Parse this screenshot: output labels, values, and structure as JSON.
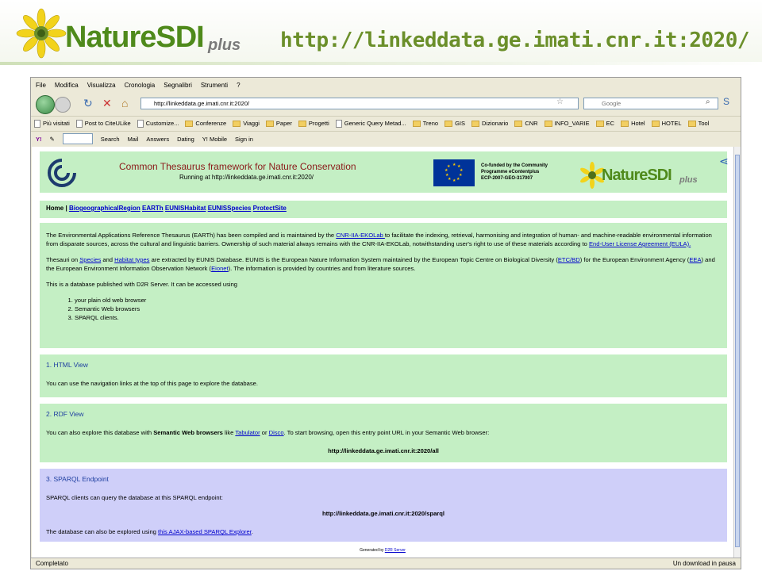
{
  "slide": {
    "logo_word": "NatureSDI",
    "logo_plus": "plus",
    "url": "http://linkeddata.ge.imati.cnr.it:2020/"
  },
  "browser": {
    "menu": [
      "File",
      "Modifica",
      "Visualizza",
      "Cronologia",
      "Segnalibri",
      "Strumenti",
      "?"
    ],
    "address": "http://linkeddata.ge.imati.cnr.it:2020/",
    "search_placeholder": "Google",
    "bookmarks": [
      "Più visitati",
      "Post to CiteULike",
      "Customize...",
      "Conferenze",
      "Viaggi",
      "Paper",
      "Progetti",
      "Generic Query Metad...",
      "Treno",
      "GIS",
      "Dizionario",
      "CNR",
      "INFO_VARIE",
      "EC",
      "Hotel",
      "HOTEL",
      "Tool"
    ],
    "yahoo_toolbar": [
      "Search",
      "Mail",
      "Answers",
      "Dating",
      "Y! Mobile",
      "Sign in"
    ],
    "status_left": "Completato",
    "status_right": "Un download in pausa"
  },
  "page": {
    "title": "Common Thesaurus framework for Nature Conservation",
    "subtitle": "Running at http://linkeddata.ge.imati.cnr.it:2020/",
    "eu_text": [
      "Co-funded by the Community",
      "Programme eContentplus",
      "ECP-2007-GEO-317007"
    ],
    "nsdi_word": "NatureSDI",
    "nsdi_plus": "plus",
    "nav_home": "Home",
    "nav_sep": "|",
    "nav_links": [
      "BiogeographicalRegion",
      "EARTh",
      "EUNISHabitat",
      "EUNISSpecies",
      "ProtectSite"
    ],
    "intro": {
      "p1_a": "The Environmental Applications Reference Thesaurus (EARTh) has been compiled and is maintained by the ",
      "p1_link1": "CNR-IIA-EKOLab ",
      "p1_b": "to facilitate the indexing, retrieval, harmonising and integration of human- and machine-readable environmental information from disparate sources, across the cultural and linguistic barriers. Ownership of such material always remains with the CNR-IIA-EKOLab, notwithstanding user's right to use of these materials according to ",
      "p1_link2": "End-User License Agreement (EULA).",
      "p2_a": "Thesauri on ",
      "p2_link1": "Species",
      "p2_b": " and ",
      "p2_link2": "Habitat types",
      "p2_c": " are extracted by EUNIS Database. EUNIS is the European Nature Information System maintained by the European Topic Centre on Biological Diversity (",
      "p2_link3": "ETC/BD",
      "p2_d": ") for the European Environment Agency (",
      "p2_link4": "EEA",
      "p2_e": ") and the European Environment Information Observation Network (",
      "p2_link5": "Eionet",
      "p2_f": "). The information is provided by countries and from literature sources.",
      "p3": "This is a database published with D2R Server. It can be accessed using",
      "list": [
        "your plain old web browser",
        "Semantic Web browsers",
        "SPARQL clients."
      ]
    },
    "html_view": {
      "title": "1. HTML View",
      "text": "You can use the navigation links at the top of this page to explore the database."
    },
    "rdf_view": {
      "title": "2. RDF View",
      "text_a": "You can also explore this database with ",
      "text_bold": "Semantic Web browsers",
      "text_b": " like ",
      "link1": "Tabulator",
      "text_c": " or ",
      "link2": "Disco",
      "text_d": ". To start browsing, open this entry point URL in your Semantic Web browser:",
      "url": "http://linkeddata.ge.imati.cnr.it:2020/all"
    },
    "sparql": {
      "title": "3. SPARQL Endpoint",
      "text": "SPARQL clients can query the database at this SPARQL endpoint:",
      "url": "http://linkeddata.ge.imati.cnr.it:2020/sparql",
      "text2_a": "The database can also be explored using ",
      "link": "this AJAX-based SPARQL Explorer",
      "text2_b": "."
    },
    "generated_a": "Generated by ",
    "generated_link": "D2R Server"
  },
  "colors": {
    "green_box": "#c4efc4",
    "blue_box": "#cfcff9",
    "logo_green": "#4f8a1b",
    "title_red": "#8b1a1a"
  }
}
